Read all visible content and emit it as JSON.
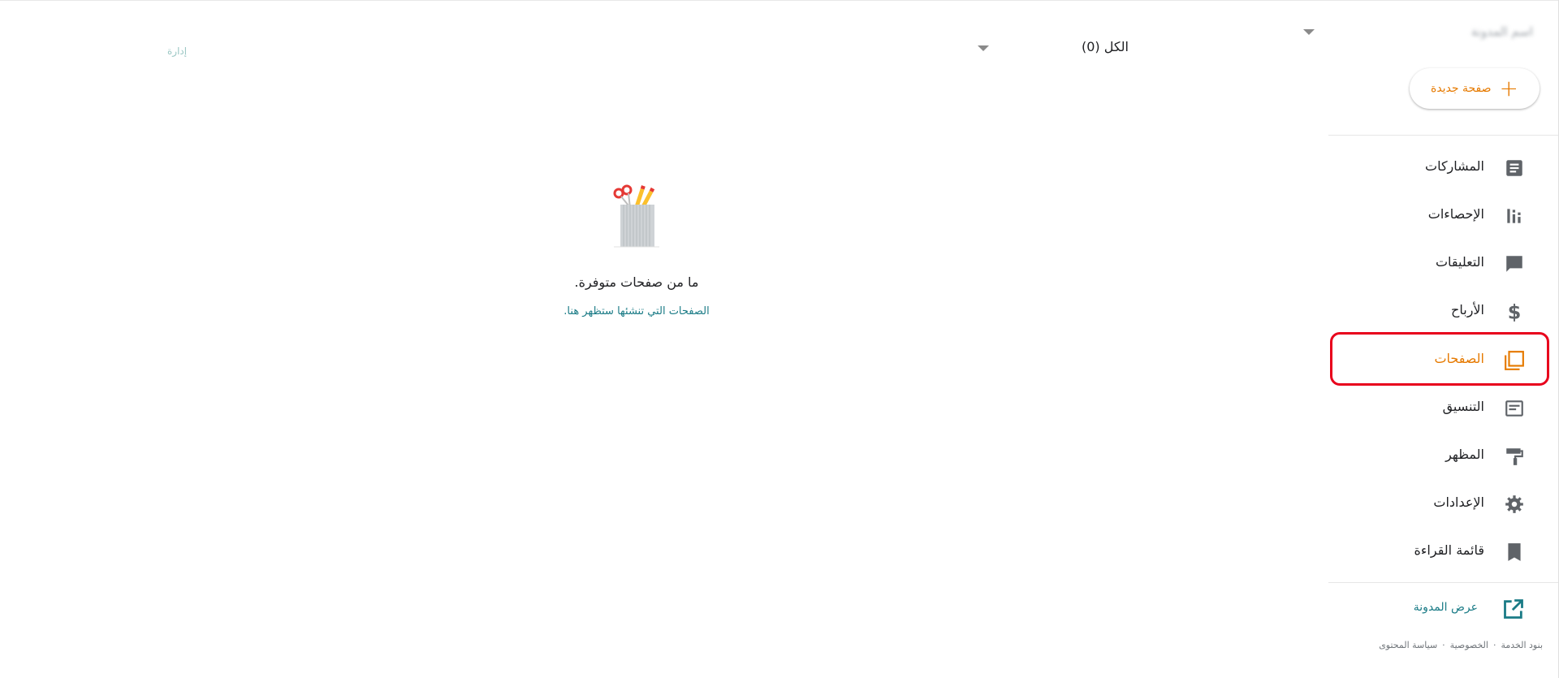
{
  "sidebar": {
    "blog_name": "اسم المدونة",
    "new_page_label": "صفحة جديدة",
    "new_page_icon": "plus-icon",
    "items": [
      {
        "label": "المشاركات",
        "icon": "posts-icon"
      },
      {
        "label": "الإحصاءات",
        "icon": "stats-icon"
      },
      {
        "label": "التعليقات",
        "icon": "comments-icon"
      },
      {
        "label": "الأرباح",
        "icon": "earnings-icon"
      },
      {
        "label": "الصفحات",
        "icon": "pages-icon",
        "active": true
      },
      {
        "label": "التنسيق",
        "icon": "layout-icon"
      },
      {
        "label": "المظهر",
        "icon": "theme-icon"
      },
      {
        "label": "الإعدادات",
        "icon": "settings-icon"
      },
      {
        "label": "قائمة القراءة",
        "icon": "reading-list-icon"
      }
    ],
    "view_blog_label": "عرض المدونة",
    "view_blog_icon": "open-in-new-icon",
    "footer_links": [
      "بنود الخدمة",
      "الخصوصية",
      "سياسة المحتوى"
    ]
  },
  "toolbar": {
    "filter_value": "الكل (0)",
    "manage_label": "إدارة"
  },
  "empty_state": {
    "icon": "pencil-cup-icon",
    "title": "ما من صفحات متوفرة.",
    "subtitle": "الصفحات التي تنشئها ستظهر هنا."
  },
  "colors": {
    "accent": "#e67a00",
    "link": "#1a7b86",
    "highlight_border": "#e8001c",
    "icon": "#5f6368"
  }
}
